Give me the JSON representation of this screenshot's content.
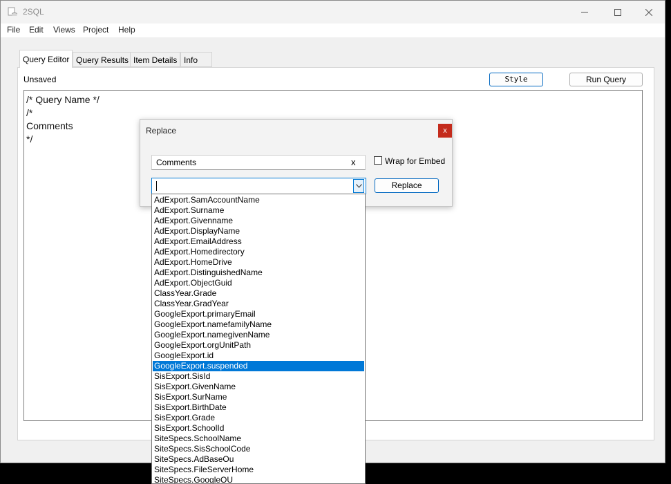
{
  "window": {
    "title": "2SQL"
  },
  "menu": [
    "File",
    "Edit",
    "Views",
    "Project",
    "Help"
  ],
  "tabs": [
    "Query Editor",
    "Query Results",
    "Item Details",
    "Info"
  ],
  "status": "Unsaved",
  "buttons": {
    "style": "Style",
    "run_query": "Run Query"
  },
  "editor": {
    "lines": [
      "/* Query Name */",
      "/*",
      "Comments",
      "*/"
    ]
  },
  "replace_dialog": {
    "title": "Replace",
    "close_glyph": "x",
    "find_value": "Comments",
    "clear_glyph": "x",
    "wrap_label": "Wrap for Embed",
    "replace_label": "Replace",
    "replace_value": ""
  },
  "dropdown": {
    "selected_index": 16,
    "items": [
      "AdExport.SamAccountName",
      "AdExport.Surname",
      "AdExport.Givenname",
      "AdExport.DisplayName",
      "AdExport.EmailAddress",
      "AdExport.Homedirectory",
      "AdExport.HomeDrive",
      "AdExport.DistinguishedName",
      "AdExport.ObjectGuid",
      "ClassYear.Grade",
      "ClassYear.GradYear",
      "GoogleExport.primaryEmail",
      "GoogleExport.namefamilyName",
      "GoogleExport.namegivenName",
      "GoogleExport.orgUnitPath",
      "GoogleExport.id",
      "GoogleExport.suspended",
      "SisExport.SisId",
      "SisExport.GivenName",
      "SisExport.SurName",
      "SisExport.BirthDate",
      "SisExport.Grade",
      "SisExport.SchoolId",
      "SiteSpecs.SchoolName",
      "SiteSpecs.SisSchoolCode",
      "SiteSpecs.AdBaseOu",
      "SiteSpecs.FileServerHome",
      "SiteSpecs.GoogleOU"
    ]
  }
}
